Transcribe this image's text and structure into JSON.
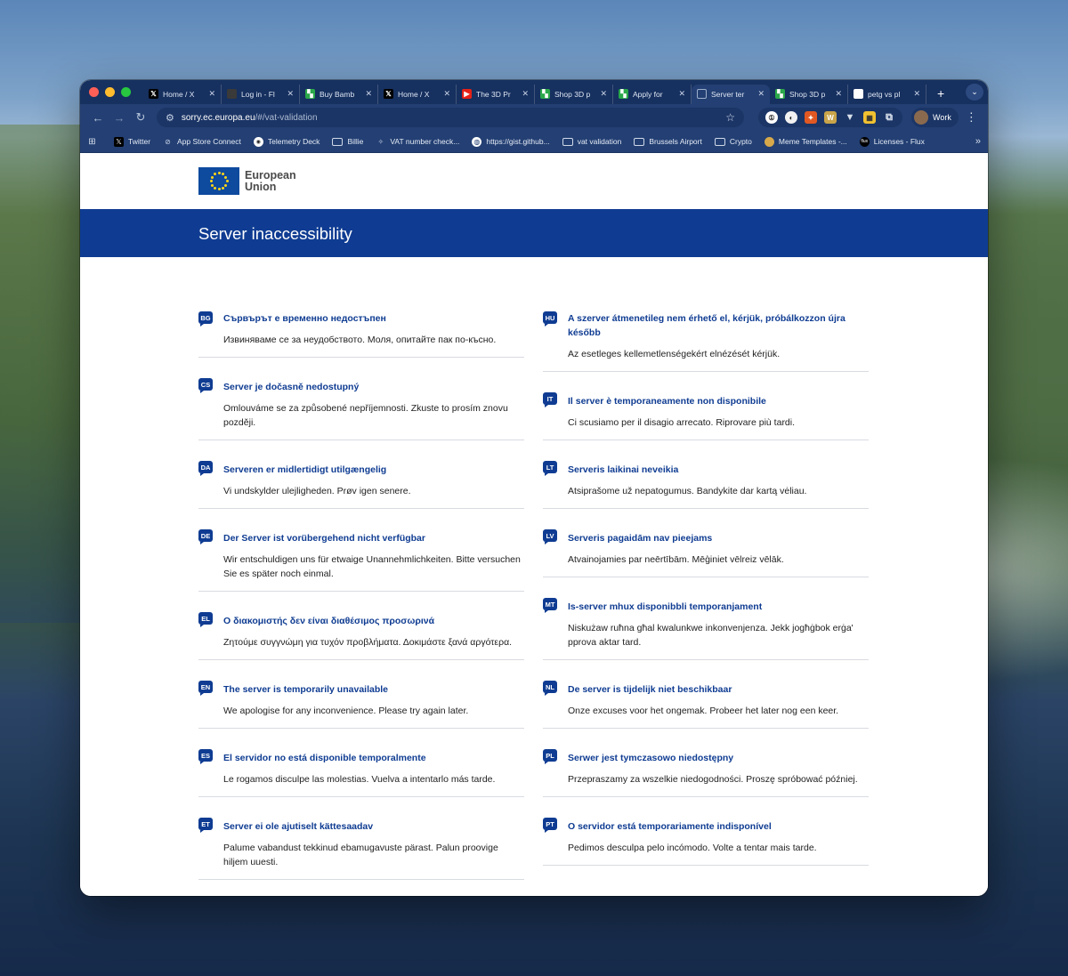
{
  "browser": {
    "tabs": [
      {
        "title": "Home / X",
        "icon": "x-logo-icon"
      },
      {
        "title": "Log in - Fl",
        "icon": "flux-icon"
      },
      {
        "title": "Buy Bamb",
        "icon": "bambu-icon"
      },
      {
        "title": "Home / X",
        "icon": "x-logo-icon"
      },
      {
        "title": "The 3D Pr",
        "icon": "youtube-icon"
      },
      {
        "title": "Shop 3D p",
        "icon": "bambu-icon"
      },
      {
        "title": "Apply for",
        "icon": "bambu-icon"
      },
      {
        "title": "Server ter",
        "icon": "loading-icon",
        "active": true
      },
      {
        "title": "Shop 3D p",
        "icon": "bambu-icon"
      },
      {
        "title": "petg vs pl",
        "icon": "google-icon"
      }
    ],
    "url_host": "sorry.ec.europa.eu",
    "url_path": "/#/vat-validation",
    "profile_label": "Work",
    "bookmarks": [
      {
        "label": "Twitter",
        "icon": "x-logo-icon"
      },
      {
        "label": "App Store Connect",
        "icon": "app-store-icon"
      },
      {
        "label": "Telemetry Deck",
        "icon": "telemetry-icon"
      },
      {
        "label": "Billie",
        "icon": "folder-icon"
      },
      {
        "label": "VAT number check...",
        "icon": "eu-icon"
      },
      {
        "label": "https://gist.github...",
        "icon": "globe-icon"
      },
      {
        "label": "vat validation",
        "icon": "folder-icon"
      },
      {
        "label": "Brussels Airport",
        "icon": "folder-icon"
      },
      {
        "label": "Crypto",
        "icon": "folder-icon"
      },
      {
        "label": "Meme Templates -...",
        "icon": "doge-icon"
      },
      {
        "label": "Licenses - Flux",
        "icon": "flux-icon"
      }
    ]
  },
  "page": {
    "logo_text_1": "European",
    "logo_text_2": "Union",
    "banner_title": "Server inaccessibility",
    "left_messages": [
      {
        "code": "BG",
        "title": "Сървърът е временно недостъпен",
        "body": "Извиняваме се за неудобството. Моля, опитайте пак по-късно."
      },
      {
        "code": "CS",
        "title": "Server je dočasně nedostupný",
        "body": "Omlouváme se za způsobené nepříjemnosti. Zkuste to prosím znovu později."
      },
      {
        "code": "DA",
        "title": "Serveren er midlertidigt utilgængelig",
        "body": "Vi undskylder ulejligheden. Prøv igen senere."
      },
      {
        "code": "DE",
        "title": "Der Server ist vorübergehend nicht verfügbar",
        "body": "Wir entschuldigen uns für etwaige Unannehmlichkeiten. Bitte versuchen Sie es später noch einmal."
      },
      {
        "code": "EL",
        "title": "Ο διακομιστής δεν είναι διαθέσιμος προσωρινά",
        "body": "Ζητούμε συγγνώμη για τυχόν προβλήματα. Δοκιμάστε ξανά αργότερα."
      },
      {
        "code": "EN",
        "title": "The server is temporarily unavailable",
        "body": "We apologise for any inconvenience. Please try again later."
      },
      {
        "code": "ES",
        "title": "El servidor no está disponible temporalmente",
        "body": "Le rogamos disculpe las molestias. Vuelva a intentarlo más tarde."
      },
      {
        "code": "ET",
        "title": "Server ei ole ajutiselt kättesaadav",
        "body": "Palume vabandust tekkinud ebamugavuste pärast. Palun proovige hiljem uuesti."
      }
    ],
    "right_messages": [
      {
        "code": "HU",
        "title": "A szerver átmenetileg nem érhető el, kérjük, próbálkozzon újra később",
        "body": "Az esetleges kellemetlenségekért elnézését kérjük."
      },
      {
        "code": "IT",
        "title": "Il server è temporaneamente non disponibile",
        "body": "Ci scusiamo per il disagio arrecato. Riprovare più tardi."
      },
      {
        "code": "LT",
        "title": "Serveris laikinai neveikia",
        "body": "Atsiprašome už nepatogumus. Bandykite dar kartą vėliau."
      },
      {
        "code": "LV",
        "title": "Serveris pagaidām nav pieejams",
        "body": "Atvainojamies par neērtībām. Mēģiniet vēlreiz vēlāk."
      },
      {
        "code": "MT",
        "title": "Is-server mhux disponibbli temporanjament",
        "body": "Niskużaw ruħna għal kwalunkwe inkonvenjenza. Jekk jogħġbok erġa' pprova aktar tard."
      },
      {
        "code": "NL",
        "title": "De server is tijdelijk niet beschikbaar",
        "body": "Onze excuses voor het ongemak. Probeer het later nog een keer."
      },
      {
        "code": "PL",
        "title": "Serwer jest tymczasowo niedostępny",
        "body": "Przepraszamy za wszelkie niedogodności. Proszę spróbować później."
      },
      {
        "code": "PT",
        "title": "O servidor está temporariamente indisponível",
        "body": "Pedimos desculpa pelo incómodo. Volte a tentar mais tarde."
      }
    ]
  },
  "colors": {
    "eu_blue": "#0f3c92",
    "browser_frame": "#233f73"
  }
}
